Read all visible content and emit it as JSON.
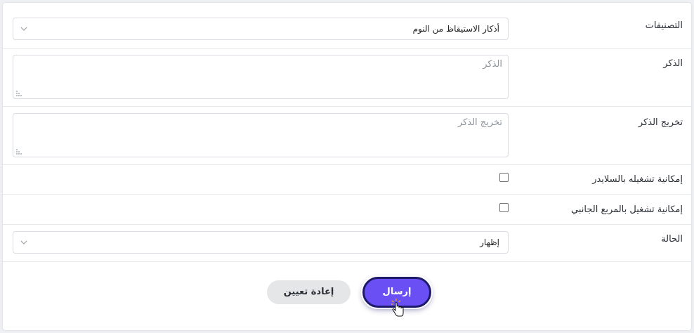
{
  "form": {
    "categories": {
      "label": "التصنيفات",
      "value": "أذكار الاستيقاظ من النوم"
    },
    "dhikr": {
      "label": "الذكر",
      "placeholder": "الذكر"
    },
    "takhrij": {
      "label": "تخريج الذكر",
      "placeholder": "تخريج الذكر"
    },
    "slider_option": {
      "label": "إمكانية تشغيله بالسلايدر",
      "checked": false
    },
    "sidebox_option": {
      "label": "إمكانية تشغيل بالمربع الجانبي",
      "checked": false
    },
    "status": {
      "label": "الحالة",
      "value": "إظهار"
    }
  },
  "actions": {
    "submit_label": "إرسال",
    "reset_label": "إعادة تعيين"
  },
  "colors": {
    "accent": "#6a4ff5",
    "accent_border": "#1e1a6a",
    "reset_bg": "#e5e6e8"
  },
  "icons": [
    "chevron-down-icon",
    "resize-grip-icon",
    "hand-cursor-icon"
  ]
}
